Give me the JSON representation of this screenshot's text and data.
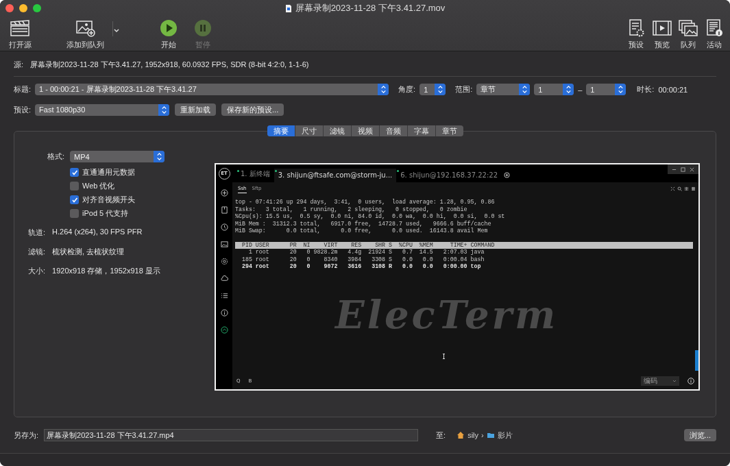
{
  "window": {
    "title": "屏幕录制2023-11-28 下午3.41.27.mov"
  },
  "toolbar": {
    "left": [
      {
        "kind": "open",
        "label": "打开源",
        "disabled": false
      },
      {
        "kind": "add_queue",
        "label": "添加到队列",
        "disabled": false
      },
      {
        "kind": "start",
        "label": "开始",
        "disabled": false
      },
      {
        "kind": "pause",
        "label": "暂停",
        "disabled": true
      }
    ],
    "right": [
      {
        "kind": "presets",
        "label": "预设",
        "disabled": false
      },
      {
        "kind": "preview",
        "label": "预览",
        "disabled": false
      },
      {
        "kind": "queue",
        "label": "队列",
        "disabled": false
      },
      {
        "kind": "activity",
        "label": "活动",
        "disabled": false
      }
    ]
  },
  "source": {
    "label": "源:",
    "value": "屏幕录制2023-11-28 下午3.41.27, 1952x918, 60.0932 FPS, SDR (8-bit 4:2:0, 1-1-6)"
  },
  "title_row": {
    "label": "标题:",
    "value": "1 - 00:00:21 - 屏幕录制2023-11-28 下午3.41.27",
    "angle_label": "角度:",
    "angle": "1",
    "range_label": "范围:",
    "range_type": "章节",
    "range_start": "1",
    "range_sep": "–",
    "range_end": "1",
    "duration_label": "时长:",
    "duration": "00:00:21"
  },
  "preset_row": {
    "label": "预设:",
    "value": "Fast 1080p30",
    "buttons": [
      "重新加载",
      "保存新的预设..."
    ]
  },
  "tabs": [
    {
      "label": "摘要",
      "selected": true
    },
    {
      "label": "尺寸",
      "selected": false
    },
    {
      "label": "滤镜",
      "selected": false
    },
    {
      "label": "视频",
      "selected": false
    },
    {
      "label": "音频",
      "selected": false
    },
    {
      "label": "字幕",
      "selected": false
    },
    {
      "label": "章节",
      "selected": false
    }
  ],
  "summary": {
    "format_label": "格式:",
    "format": "MP4",
    "options": [
      {
        "label": "直通通用元数据",
        "checked": true
      },
      {
        "label": "Web 优化",
        "checked": false
      },
      {
        "label": "对齐音视频开头",
        "checked": true
      },
      {
        "label": "iPod 5 代支持",
        "checked": false
      }
    ],
    "info": [
      {
        "label": "轨道:",
        "value": "H.264 (x264), 30 FPS PFR"
      },
      {
        "label": "滤镜:",
        "value": "梳状检测, 去梳状纹理"
      },
      {
        "label": "大小:",
        "value": "1920x918 存储，1952x918 显示"
      }
    ]
  },
  "preview": {
    "logo": "ET",
    "tabs": [
      {
        "label": "1. 新终端",
        "selected": false
      },
      {
        "label": "3. shijun@ftsafe.com@storm-ju...",
        "selected": true
      },
      {
        "label": "6. shijun@192.168.37.22:22",
        "selected": false
      }
    ],
    "subtabs": [
      {
        "label": "Ssh",
        "selected": true
      },
      {
        "label": "Sftp",
        "selected": false
      }
    ],
    "lines": [
      "top - 07:41:26 up 294 days,  3:41,  0 users,  load average: 1.28, 0.95, 0.86",
      "Tasks:   3 total,   1 running,   2 sleeping,   0 stopped,   0 zombie",
      "%Cpu(s): 15.5 us,  0.5 sy,  0.0 ni, 84.0 id,  0.0 wa,  0.0 hi,  0.0 si,  0.0 st",
      "MiB Mem :  31312.3 total,   6917.0 free,  14728.7 used,   9666.6 buff/cache",
      "MiB Swap:      0.0 total,      0.0 free,      0.0 used.  16143.8 avail Mem"
    ],
    "table_header": "  PID USER      PR  NI    VIRT    RES    SHR S  %CPU  %MEM     TIME+ COMMAND",
    "table_rows": [
      {
        "text": "    1 root      20   0 9828.2m   4.4g  21924 S   0.7  14.5   2:07.03 java",
        "emphasized": false
      },
      {
        "text": "  185 root      20   0    8340   3984   3308 S   0.0   0.0   0:00.04 bash",
        "emphasized": false
      },
      {
        "text": "  294 root      20   0    9072   3616   3108 R   0.0   0.0   0:00.00 top",
        "emphasized": true
      }
    ],
    "watermark_logo": "ElecTerm",
    "bottom_buttons": [
      "Q",
      "B"
    ],
    "encoding": "编码"
  },
  "save": {
    "label": "另存为:",
    "value": "屏幕录制2023-11-28 下午3.41.27.mp4",
    "to_label": "至:",
    "path": [
      "sily",
      "影片"
    ],
    "path_sep": "›",
    "browse": "浏览..."
  }
}
